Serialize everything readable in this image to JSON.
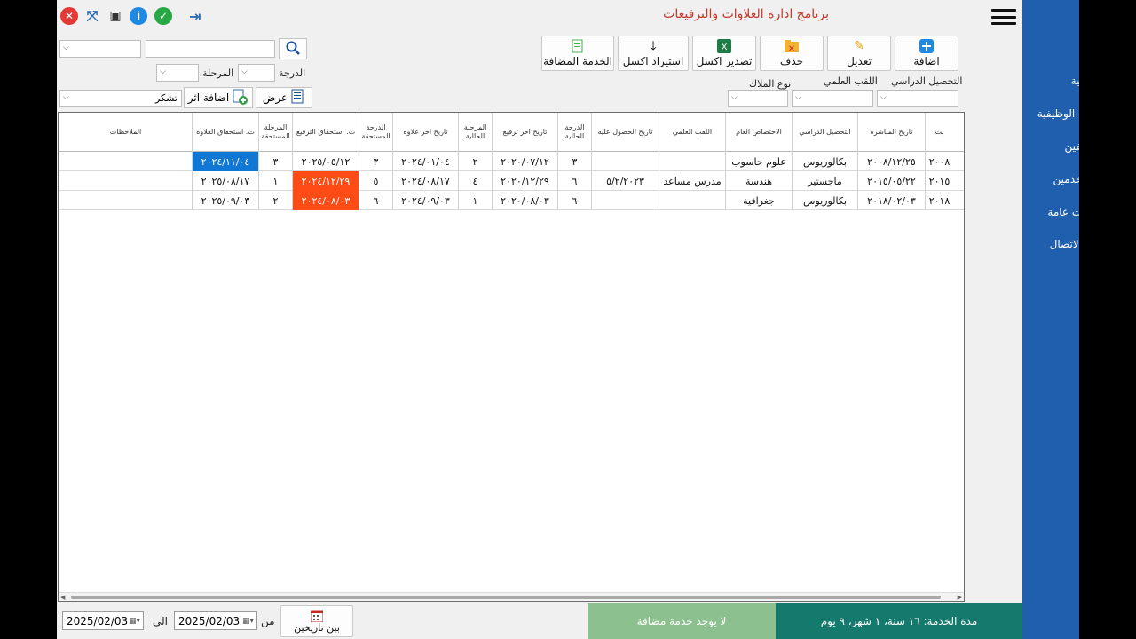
{
  "titlebar": {
    "app_title": "برنامج ادارة العلاوات والترفيعات",
    "icons": [
      "close-icon",
      "fullscreen-icon",
      "window-icon",
      "info-icon",
      "check-icon",
      "logout-icon"
    ]
  },
  "toolbar": {
    "add_label": "اضافة",
    "edit_label": "تعديل",
    "delete_label": "حذف",
    "export_excel_label": "تصدير اكسل",
    "import_excel_label": "استيراد اكسل",
    "added_service_label": "الخدمة المضافة"
  },
  "filters": {
    "education_label": "التحصيل الدراسي",
    "academic_title_label": "اللقب العلمي",
    "staff_type_label": "نوع الملاك",
    "grade_label": "الدرجة",
    "stage_label": "المرحلة",
    "search_value": "",
    "show_button": "عرض",
    "add_effect_button": "اضافة اثر",
    "effect_value": "تشكر"
  },
  "sidebar": {
    "items": [
      {
        "label": "الرئيسية",
        "icon": "home-icon"
      },
      {
        "label": "الدرجة الوظيفية",
        "icon": "org-chart-icon"
      },
      {
        "label": "الموظفين",
        "icon": "employees-icon"
      },
      {
        "label": "المستخدمين",
        "icon": "users-icon"
      },
      {
        "label": "اعدادات عامة",
        "icon": "settings-icon"
      },
      {
        "label": "ضبط الاتصال",
        "icon": "database-icon"
      }
    ]
  },
  "grid": {
    "columns": [
      "بت",
      "تاريخ المباشرة",
      "التحصيل الدراسي",
      "الاختصاص العام",
      "اللقب العلمي",
      "تاريخ الحصول عليه",
      "الدرجة الحالية",
      "تاريخ اخر ترفيع",
      "المرحلة الحالية",
      "تاريخ اخر علاوة",
      "الدرجة المستحقة",
      "ت. استحقاق الترفيع",
      "المرحلة المستحقة",
      "ت. استحقاق العلاوة",
      "الملاحظات"
    ],
    "rows": [
      {
        "c0": "٢٠٠٨",
        "c1": "٢٠٠٨/١٢/٢٥",
        "c2": "بكالوريوس",
        "c3": "علوم حاسوب",
        "c4": "",
        "c5": "",
        "c6": "٣",
        "c7": "٢٠٢٠/٠٧/١٢",
        "c8": "٢",
        "c9": "٢٠٢٤/٠١/٠٤",
        "c10": "٣",
        "c11": "٢٠٢٥/٠٥/١٢",
        "c12": "٣",
        "c13": "٢٠٢٤/١١/٠٤",
        "c14": ""
      },
      {
        "c0": "٢٠١٥",
        "c1": "٢٠١٥/٠٥/٢٢",
        "c2": "ماجستير",
        "c3": "هندسة",
        "c4": "مدرس مساعد",
        "c5": "٥/٢/٢٠٢٣",
        "c6": "٦",
        "c7": "٢٠٢٠/١٢/٢٩",
        "c8": "٤",
        "c9": "٢٠٢٤/٠٨/١٧",
        "c10": "٥",
        "c11": "٢٠٢٤/١٢/٢٩",
        "c12": "١",
        "c13": "٢٠٢٥/٠٨/١٧",
        "c14": ""
      },
      {
        "c0": "٢٠١٨",
        "c1": "٢٠١٨/٠٢/٠٣",
        "c2": "بكالوريوس",
        "c3": "جغرافية",
        "c4": "",
        "c5": "",
        "c6": "٦",
        "c7": "٢٠٢٠/٠٨/٠٣",
        "c8": "١",
        "c9": "٢٠٢٤/٠٩/٠٣",
        "c10": "٦",
        "c11": "٢٠٢٤/٠٨/٠٣",
        "c12": "٢",
        "c13": "٢٠٢٥/٠٩/٠٣",
        "c14": ""
      }
    ],
    "highlight_colors": {
      "blue": "#1177d4",
      "red": "#ff4b15"
    }
  },
  "footer": {
    "date_from": "2025/02/03",
    "date_to": "2025/02/03",
    "to_label": "الى",
    "from_label": "من",
    "between_dates_button": "بين تاريخين",
    "added_service_status": "لا يوجد خدمة مضافة",
    "service_duration": "مدة الخدمة: ١٦ سنة، ١ شهر، ٩ يوم"
  },
  "colors": {
    "sidebar": "#1f5fae",
    "title": "#c0392b",
    "status_green": "#8cc18f",
    "status_teal": "#147a6d"
  }
}
